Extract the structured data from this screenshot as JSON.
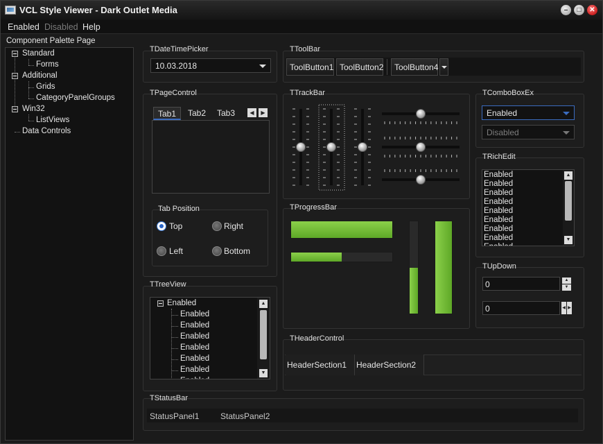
{
  "window": {
    "title": "VCL Style Viewer - Dark Outlet Media",
    "accent": "#3b6cc0",
    "progress_color": "#6cbf31"
  },
  "menu": {
    "items": [
      "Enabled",
      "Disabled",
      "Help"
    ]
  },
  "palette": {
    "label": "Component Palette Page",
    "tree": [
      {
        "label": "Standard",
        "children": [
          "Forms"
        ]
      },
      {
        "label": "Additional",
        "children": [
          "Grids",
          "CategoryPanelGroups"
        ]
      },
      {
        "label": "Win32",
        "children": [
          "ListViews"
        ]
      },
      {
        "label": "Data Controls",
        "children": []
      }
    ]
  },
  "datetimepicker": {
    "label": "TDateTimePicker",
    "value": "10.03.2018"
  },
  "toolbar": {
    "label": "TToolBar",
    "buttons": [
      "ToolButton1",
      "ToolButton2",
      "ToolButton4"
    ]
  },
  "pagecontrol": {
    "label": "TPageControl",
    "tabs": [
      "Tab1",
      "Tab2",
      "Tab3"
    ],
    "active_tab": "Tab1"
  },
  "tabposition": {
    "label": "Tab Position",
    "options": [
      "Top",
      "Right",
      "Left",
      "Bottom"
    ],
    "selected": "Top"
  },
  "trackbar": {
    "label": "TTrackBar",
    "vertical_positions": [
      0.5,
      0.5,
      0.5
    ],
    "horizontal_positions": [
      0.5,
      0.5,
      0.5
    ]
  },
  "comboboxex": {
    "label": "TComboBoxEx",
    "enabled_value": "Enabled",
    "disabled_value": "Disabled"
  },
  "richedit": {
    "label": "TRichEdit",
    "lines": [
      "Enabled",
      "Enabled",
      "Enabled",
      "Enabled",
      "Enabled",
      "Enabled",
      "Enabled",
      "Enabled",
      "Enabled",
      "Enabled"
    ]
  },
  "progressbar": {
    "label": "TProgressBar",
    "h1": 1.0,
    "h2": 0.5,
    "v1": 0.5,
    "v2": 1.0
  },
  "treeview": {
    "label": "TTreeView",
    "root": "Enabled",
    "children": [
      "Enabled",
      "Enabled",
      "Enabled",
      "Enabled",
      "Enabled",
      "Enabled",
      "Enabled"
    ]
  },
  "headercontrol": {
    "label": "THeaderControl",
    "sections": [
      "HeaderSection1",
      "HeaderSection2"
    ]
  },
  "updown": {
    "label": "TUpDown",
    "value1": "0",
    "value2": "0"
  },
  "statusbar": {
    "label": "TStatusBar",
    "panels": [
      "StatusPanel1",
      "StatusPanel2"
    ]
  }
}
